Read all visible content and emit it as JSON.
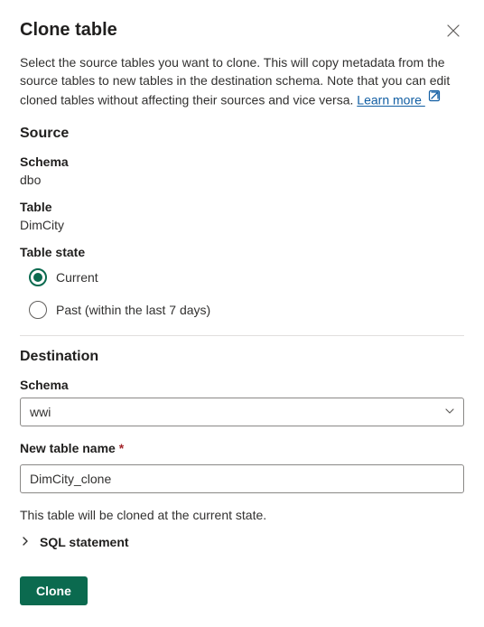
{
  "header": {
    "title": "Clone table"
  },
  "description": {
    "text": "Select the source tables you want to clone. This will copy metadata from the source tables to new tables in the destination schema. Note that you can edit cloned tables without affecting their sources and vice versa. ",
    "learn_more": "Learn more "
  },
  "source": {
    "heading": "Source",
    "schema_label": "Schema",
    "schema_value": "dbo",
    "table_label": "Table",
    "table_value": "DimCity",
    "state_label": "Table state",
    "radio_current": "Current",
    "radio_past": "Past (within the last 7 days)"
  },
  "destination": {
    "heading": "Destination",
    "schema_label": "Schema",
    "schema_value": "wwi",
    "name_label": "New table name",
    "name_value": "DimCity_clone"
  },
  "status_text": "This table will be cloned at the current state.",
  "sql_expander": "SQL statement",
  "actions": {
    "clone": "Clone"
  }
}
